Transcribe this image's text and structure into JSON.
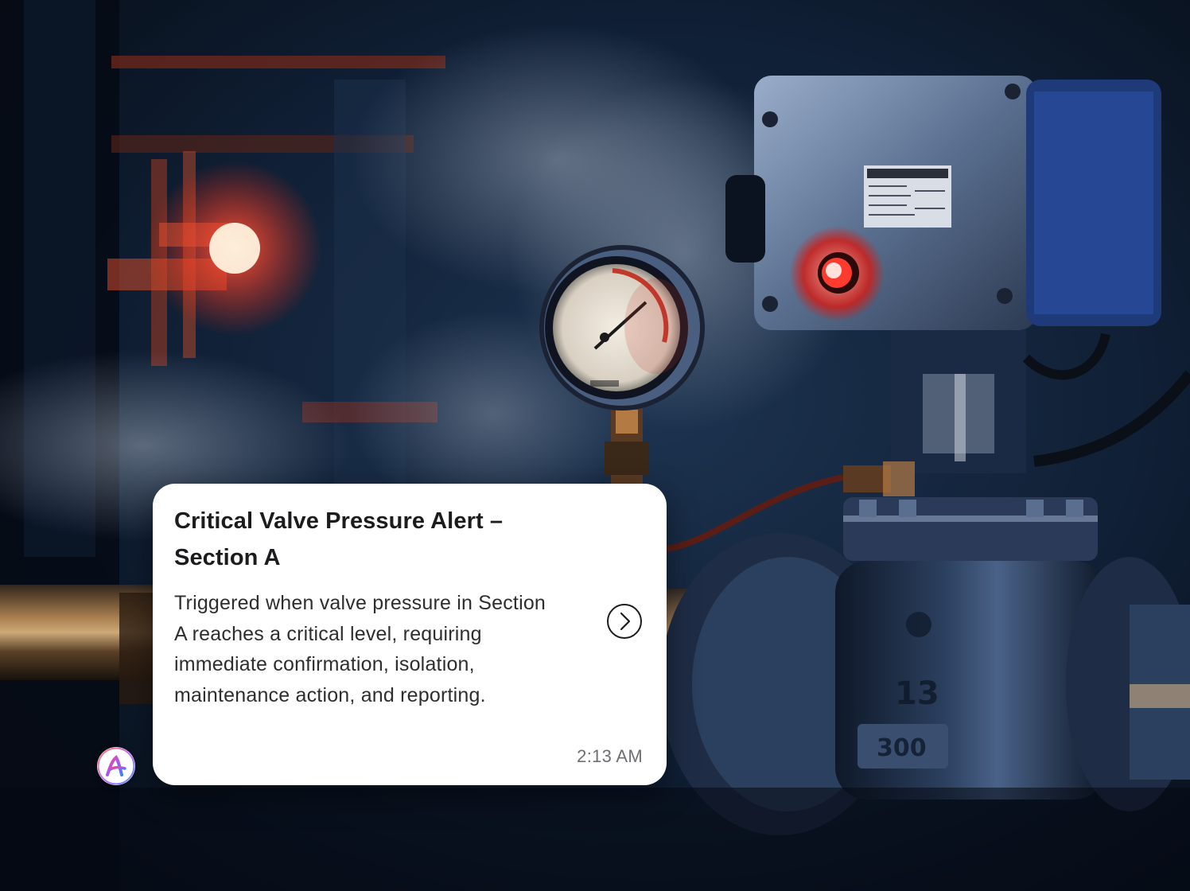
{
  "notification": {
    "title": "Critical Valve Pressure Alert – Section A",
    "body": "Triggered when valve pressure in Section A reaches a critical level, requiring immediate confirmation, isolation, maintenance action, and reporting.",
    "time": "2:13 AM",
    "action_icon": "chevron-right-circle-icon"
  },
  "avatar": {
    "icon": "assistant-logo-icon",
    "gradient_colors": [
      "#ff4b6e",
      "#a855f7",
      "#3b82f6"
    ]
  },
  "background": {
    "description_icon": "industrial-valve-photo",
    "accent_light": "#ff3b30"
  }
}
